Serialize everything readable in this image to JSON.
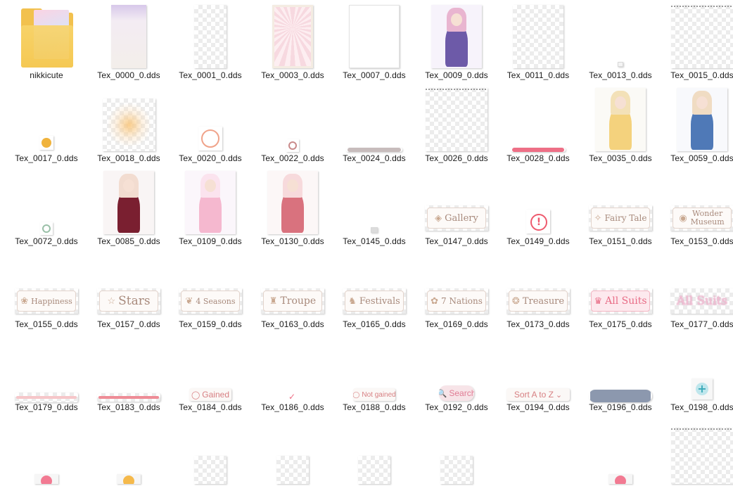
{
  "explorer": {
    "view": "large-icons",
    "items": [
      {
        "name": "nikkicute",
        "type": "folder"
      },
      {
        "name": "Tex_0000_0.dds"
      },
      {
        "name": "Tex_0001_0.dds"
      },
      {
        "name": "Tex_0003_0.dds"
      },
      {
        "name": "Tex_0007_0.dds"
      },
      {
        "name": "Tex_0009_0.dds"
      },
      {
        "name": "Tex_0011_0.dds"
      },
      {
        "name": "Tex_0013_0.dds"
      },
      {
        "name": "Tex_0015_0.dds"
      },
      {
        "name": "Tex_0017_0.dds"
      },
      {
        "name": "Tex_0018_0.dds"
      },
      {
        "name": "Tex_0020_0.dds"
      },
      {
        "name": "Tex_0022_0.dds"
      },
      {
        "name": "Tex_0024_0.dds"
      },
      {
        "name": "Tex_0026_0.dds"
      },
      {
        "name": "Tex_0028_0.dds"
      },
      {
        "name": "Tex_0035_0.dds"
      },
      {
        "name": "Tex_0059_0.dds"
      },
      {
        "name": "Tex_0072_0.dds"
      },
      {
        "name": "Tex_0085_0.dds"
      },
      {
        "name": "Tex_0109_0.dds"
      },
      {
        "name": "Tex_0130_0.dds"
      },
      {
        "name": "Tex_0145_0.dds"
      },
      {
        "name": "Tex_0147_0.dds",
        "thumb_text": "Gallery"
      },
      {
        "name": "Tex_0149_0.dds"
      },
      {
        "name": "Tex_0151_0.dds",
        "thumb_text": "Fairy Tale"
      },
      {
        "name": "Tex_0153_0.dds",
        "thumb_text": "Wonder Museum"
      },
      {
        "name": "Tex_0155_0.dds",
        "thumb_text": "Happiness"
      },
      {
        "name": "Tex_0157_0.dds",
        "thumb_text": "Stars"
      },
      {
        "name": "Tex_0159_0.dds",
        "thumb_text": "4 Seasons"
      },
      {
        "name": "Tex_0163_0.dds",
        "thumb_text": "Troupe"
      },
      {
        "name": "Tex_0165_0.dds",
        "thumb_text": "Festivals"
      },
      {
        "name": "Tex_0169_0.dds",
        "thumb_text": "7 Nations"
      },
      {
        "name": "Tex_0173_0.dds",
        "thumb_text": "Treasure"
      },
      {
        "name": "Tex_0175_0.dds",
        "thumb_text": "All Suits"
      },
      {
        "name": "Tex_0177_0.dds",
        "thumb_text": "All Suits"
      },
      {
        "name": "Tex_0179_0.dds"
      },
      {
        "name": "Tex_0183_0.dds"
      },
      {
        "name": "Tex_0184_0.dds",
        "thumb_text": "Gained"
      },
      {
        "name": "Tex_0186_0.dds"
      },
      {
        "name": "Tex_0188_0.dds",
        "thumb_text": "Not gained"
      },
      {
        "name": "Tex_0192_0.dds",
        "thumb_text": "Search"
      },
      {
        "name": "Tex_0194_0.dds",
        "thumb_text": "Sort A to Z"
      },
      {
        "name": "Tex_0196_0.dds"
      },
      {
        "name": "Tex_0198_0.dds"
      },
      {
        "name": ""
      },
      {
        "name": ""
      },
      {
        "name": ""
      },
      {
        "name": ""
      },
      {
        "name": ""
      },
      {
        "name": ""
      },
      {
        "name": ""
      },
      {
        "name": ""
      },
      {
        "name": ""
      }
    ]
  },
  "colors": {
    "label_text": "#1a1a1a",
    "button_text": "#b08a78",
    "pink_accent": "#ee6f86",
    "folder_yellow": "#f5cd62"
  }
}
